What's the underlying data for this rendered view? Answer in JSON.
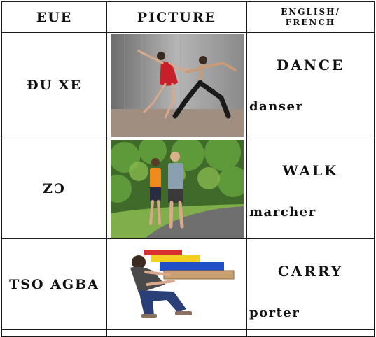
{
  "header": {
    "eue": "EUE",
    "picture": "PICTURE",
    "english_line1": "ENGLISH/",
    "english_line2": "FRENCH"
  },
  "rows": [
    {
      "eue": "ĐU XE",
      "english": "DANCE",
      "french": "danser",
      "picture_icon": "dancers-photo"
    },
    {
      "eue": "ZƆ",
      "english": "WALK",
      "french": "marcher",
      "picture_icon": "walkers-photo"
    },
    {
      "eue": "TSO AGBA",
      "english": "CARRY",
      "french": "porter",
      "picture_icon": "carrying-boxes-photo"
    }
  ]
}
